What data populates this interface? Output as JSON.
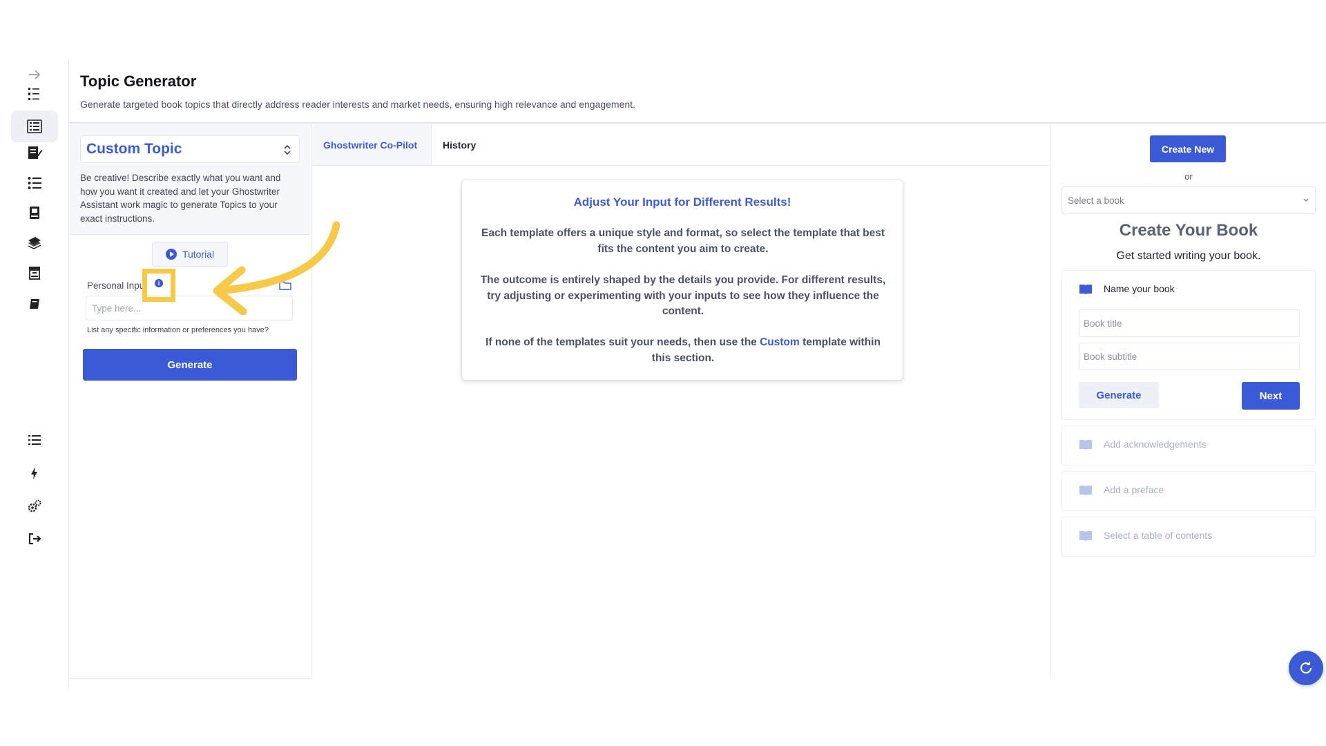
{
  "header": {
    "title": "Topic Generator",
    "subtitle": "Generate targeted book topics that directly address reader interests and market needs, ensuring high relevance and engagement."
  },
  "rail": {
    "icons": [
      "arrow-right-icon",
      "numbered-list-icon",
      "book-list-icon",
      "edit-book-icon",
      "list-icon",
      "book-stack-icon",
      "books-icon",
      "archive-icon",
      "book-icon",
      "menu-list-icon",
      "lightning-icon",
      "settings-icon",
      "logout-icon"
    ],
    "active": "book-list-icon"
  },
  "left_panel": {
    "topic_select": "Custom Topic",
    "description": "Be creative! Describe exactly what you want and how you want it created and let your Ghostwriter Assistant work magic to generate Topics to your exact instructions.",
    "tutorial_label": "Tutorial",
    "personal_input_label": "Personal Input",
    "info_icon_glyph": "i",
    "personal_input_placeholder": "Type here...",
    "personal_input_help": "List any specific information or preferences you have?",
    "generate_label": "Generate"
  },
  "tabs": [
    {
      "label": "Ghostwriter Co-Pilot",
      "active": true
    },
    {
      "label": "History",
      "active": false
    }
  ],
  "info_card": {
    "title": "Adjust Your Input for Different Results!",
    "p1": "Each template offers a unique style and format, so select the template that best fits the content you aim to create.",
    "p2": "The outcome is entirely shaped by the details you provide. For different results, try adjusting or experimenting with your inputs to see how they influence the content.",
    "p3_before": "If none of the templates suit your needs, then use the ",
    "p3_link": "Custom",
    "p3_after": " template within this section."
  },
  "right_panel": {
    "create_new_label": "Create New",
    "or_label": "or",
    "book_select_placeholder": "Select a book",
    "title": "Create Your Book",
    "subtitle": "Get started writing your book.",
    "steps": {
      "name_book": "Name your book",
      "book_title_placeholder": "Book title",
      "book_subtitle_placeholder": "Book subtitle",
      "generate_label": "Generate",
      "next_label": "Next",
      "acknowledgements": "Add acknowledgements",
      "preface": "Add a preface",
      "toc": "Select a table of contents"
    }
  },
  "colors": {
    "accent": "#3b5bd6",
    "highlight": "#f7c948",
    "panel_bg": "#f6f7fb"
  }
}
